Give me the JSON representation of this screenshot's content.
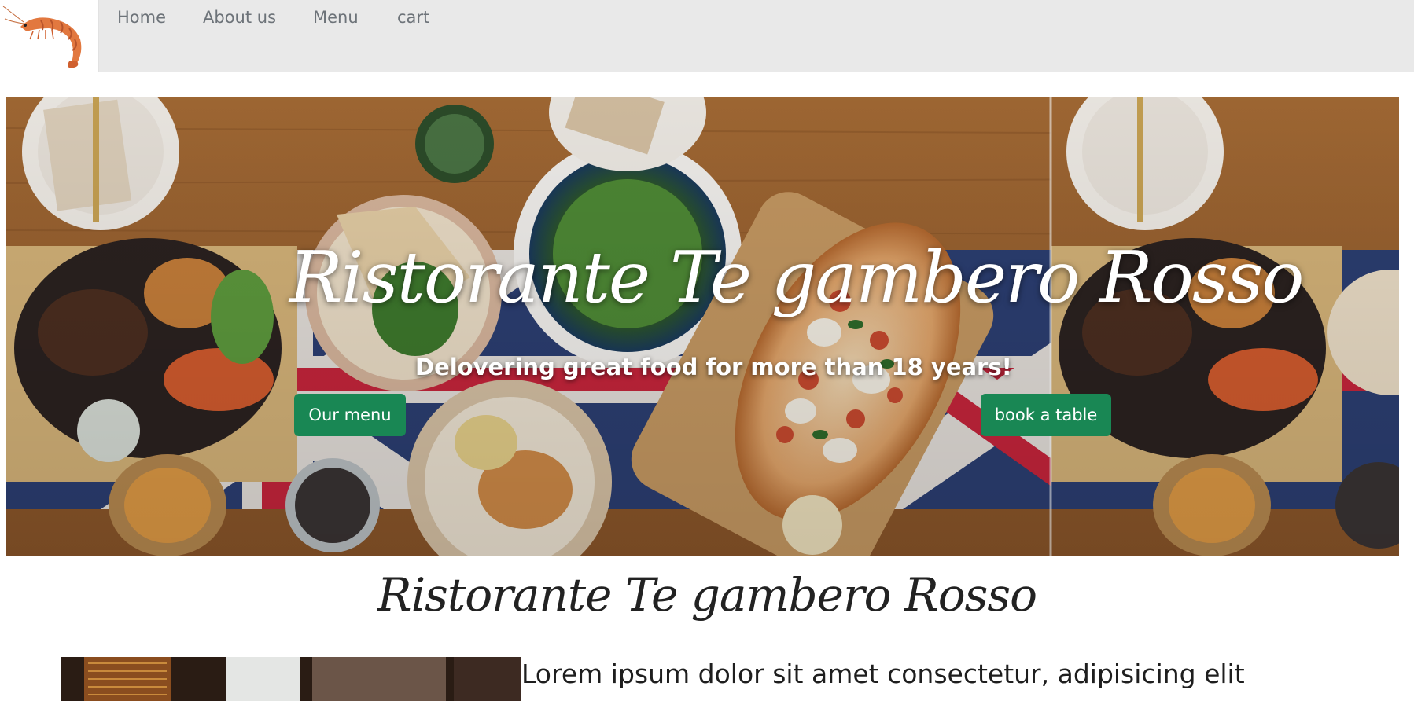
{
  "nav": {
    "logo_icon": "shrimp-icon",
    "links": [
      "Home",
      "About us",
      "Menu",
      "cart"
    ]
  },
  "hero": {
    "title": "Ristorante Te gambero Rosso",
    "subtitle": "Delovering great food for more than 18 years!",
    "menu_button": "Our menu",
    "book_button": "book a table"
  },
  "section": {
    "title": "Ristorante Te gambero Rosso",
    "heading": "Lorem ipsum dolor sit amet consectetur, adipisicing elit"
  },
  "colors": {
    "navbar_bg": "#e9e9e9",
    "button_green": "#198754",
    "nav_text": "#6d7379"
  }
}
